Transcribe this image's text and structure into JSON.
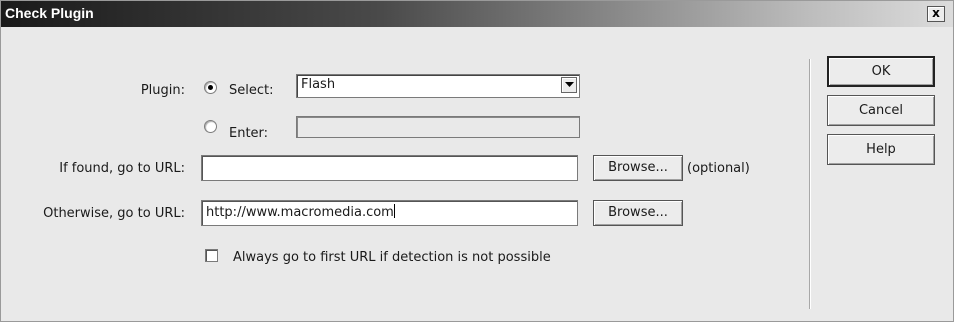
{
  "window": {
    "title": "Check Plugin",
    "close_label": "x"
  },
  "plugin": {
    "label": "Plugin:",
    "select_option_label": "Select:",
    "select_value": "Flash",
    "select_checked": true,
    "enter_option_label": "Enter:",
    "enter_value": ""
  },
  "found_url": {
    "label": "If found, go to URL:",
    "value": "",
    "browse_label": "Browse...",
    "optional_note": "(optional)"
  },
  "otherwise_url": {
    "label": "Otherwise, go to URL:",
    "value": "http://www.macromedia.com",
    "browse_label": "Browse..."
  },
  "always_first_url": {
    "label": "Always go to first URL if detection is not possible",
    "checked": false
  },
  "buttons": {
    "ok": "OK",
    "cancel": "Cancel",
    "help": "Help"
  }
}
